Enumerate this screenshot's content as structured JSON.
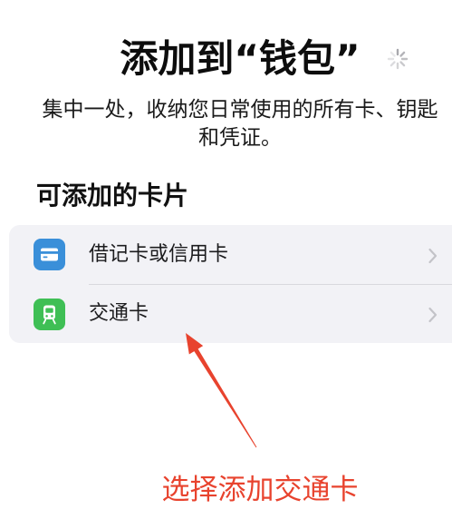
{
  "header": {
    "title": "添加到“钱包”",
    "loading_icon": "spinner-icon"
  },
  "subtitle": {
    "lines": [
      "集中一处，收纳您日常使用的所有卡、钥匙",
      "和凭证。"
    ]
  },
  "section": {
    "title": "可添加的卡片"
  },
  "card_options": [
    {
      "label": "借记卡或信用卡",
      "icon": "credit-card-icon",
      "icon_color": "#3a8fd9",
      "trailing_icon": "chevron-right-icon"
    },
    {
      "label": "交通卡",
      "icon": "train-icon",
      "icon_color": "#3fbf55",
      "trailing_icon": "chevron-right-icon"
    }
  ],
  "annotation": {
    "caption": "选择添加交通卡",
    "color": "#e8432e",
    "icon": "red-arrow-icon"
  }
}
